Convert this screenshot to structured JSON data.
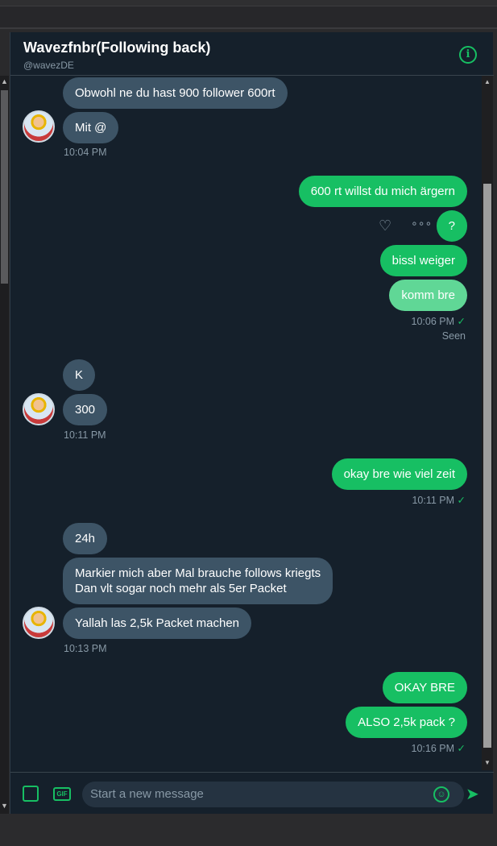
{
  "header": {
    "name": "Wavezfnbr(Following back)",
    "handle": "@wavezDE"
  },
  "messages": [
    {
      "text": "Obwohl ne du hast 900 follower 600rt"
    },
    {
      "text": "Mit @"
    },
    {
      "time": "10:04 PM"
    },
    {
      "text": "600 rt willst du mich ärgern"
    },
    {
      "text": "?"
    },
    {
      "text": "bissl weiger"
    },
    {
      "text": "komm bre"
    },
    {
      "time": "10:06 PM",
      "check": "✓",
      "seen": "Seen"
    },
    {
      "text": "K"
    },
    {
      "text": "300"
    },
    {
      "time": "10:11 PM"
    },
    {
      "text": "okay bre wie viel zeit"
    },
    {
      "time": "10:11 PM",
      "check": "✓"
    },
    {
      "text": "24h"
    },
    {
      "line1": "Markier mich aber Mal brauche follows kriegts",
      "line2": "Dan vlt sogar noch mehr als 5er Packet"
    },
    {
      "text": "Yallah las 2,5k Packet machen"
    },
    {
      "time": "10:13 PM"
    },
    {
      "text": "OKAY BRE"
    },
    {
      "text": "ALSO 2,5k pack ?"
    },
    {
      "time": "10:16 PM",
      "check": "✓"
    }
  ],
  "icons": {
    "info": "info-icon",
    "like": "heart-plus-icon",
    "more": "more-icon",
    "image": "image-icon",
    "gif": "gif-icon",
    "emoji": "emoji-icon",
    "send": "send-icon"
  },
  "composer": {
    "placeholder": "Start a new message",
    "gif_label": "GIF"
  },
  "colors": {
    "accent": "#17bf63",
    "background": "#15202b",
    "incoming": "#3d5466"
  }
}
